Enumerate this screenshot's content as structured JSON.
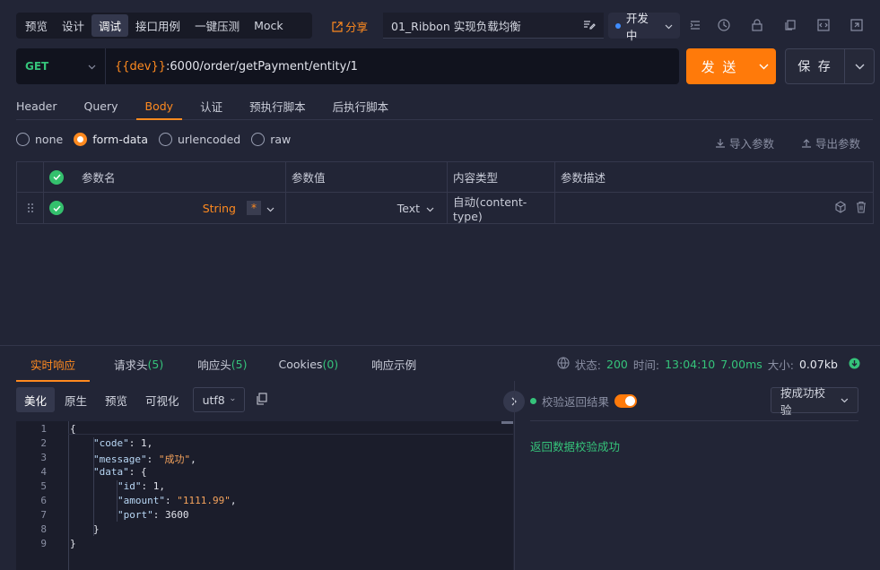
{
  "mode_tabs": [
    "预览",
    "设计",
    "调试",
    "接口用例",
    "一键压测",
    "Mock"
  ],
  "active_mode": 2,
  "share_label": "分享",
  "api_title": "01_Ribbon 实现负载均衡",
  "env_label": "开发中",
  "method": "GET",
  "url": {
    "var": "{{dev}}",
    "path": ":6000/order/getPayment/entity/1"
  },
  "send_label": "发 送",
  "save_label": "保 存",
  "req_tabs": [
    "Header",
    "Query",
    "Body",
    "认证",
    "预执行脚本",
    "后执行脚本"
  ],
  "active_req_tab": 2,
  "body_types": [
    "none",
    "form-data",
    "urlencoded",
    "raw"
  ],
  "selected_body_type": 1,
  "import_label": "导入参数",
  "export_label": "导出参数",
  "table": {
    "headers": [
      "参数名",
      "参数值",
      "内容类型",
      "参数描述"
    ],
    "row": {
      "type": "String",
      "required": "*",
      "value_type": "Text",
      "content_type": "自动(content-type)"
    }
  },
  "resp_tabs": [
    {
      "label": "实时响应",
      "count": ""
    },
    {
      "label": "请求头",
      "count": "(5)"
    },
    {
      "label": "响应头",
      "count": "(5)"
    },
    {
      "label": "Cookies",
      "count": "(0)"
    },
    {
      "label": "响应示例",
      "count": ""
    }
  ],
  "status": {
    "status_label": "状态:",
    "code": "200",
    "time_label": "时间:",
    "clock": "13:04:10",
    "duration": "7.00ms",
    "size_label": "大小:",
    "size": "0.07kb"
  },
  "view_tabs": [
    "美化",
    "原生",
    "预览",
    "可视化"
  ],
  "encoding": "utf8",
  "code_lines": [
    "1",
    "2",
    "3",
    "4",
    "5",
    "6",
    "7",
    "8",
    "9"
  ],
  "json": {
    "k_code": "\"code\"",
    "v_code": "1",
    "k_message": "\"message\"",
    "v_message": "\"成功\"",
    "k_data": "\"data\"",
    "k_id": "\"id\"",
    "v_id": "1",
    "k_amount": "\"amount\"",
    "v_amount": "\"1111.99\"",
    "k_port": "\"port\"",
    "v_port": "3600"
  },
  "verify_label": "校验返回结果",
  "verify_mode": "按成功校验",
  "verify_result": "返回数据校验成功",
  "colors": {
    "accent": "#ff7a0a",
    "success": "#35c37a",
    "env_dot": "#3f8cff"
  }
}
